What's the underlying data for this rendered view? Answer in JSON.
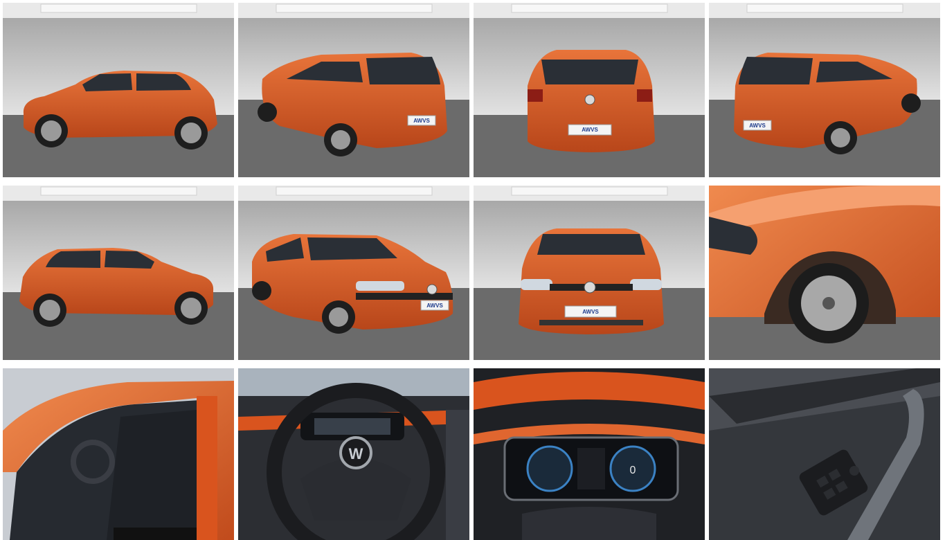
{
  "gallery": {
    "accent_color": "#d9541e",
    "plate_text": "AWVS",
    "photos": [
      {
        "view": "side-left"
      },
      {
        "view": "rear-three-quarter-left"
      },
      {
        "view": "rear"
      },
      {
        "view": "rear-three-quarter-right"
      },
      {
        "view": "side-right"
      },
      {
        "view": "front-three-quarter-right"
      },
      {
        "view": "front"
      },
      {
        "view": "wheel-detail"
      },
      {
        "view": "interior-driver-door"
      },
      {
        "view": "steering-wheel"
      },
      {
        "view": "instrument-cluster"
      },
      {
        "view": "door-panel-window-switches"
      }
    ]
  }
}
